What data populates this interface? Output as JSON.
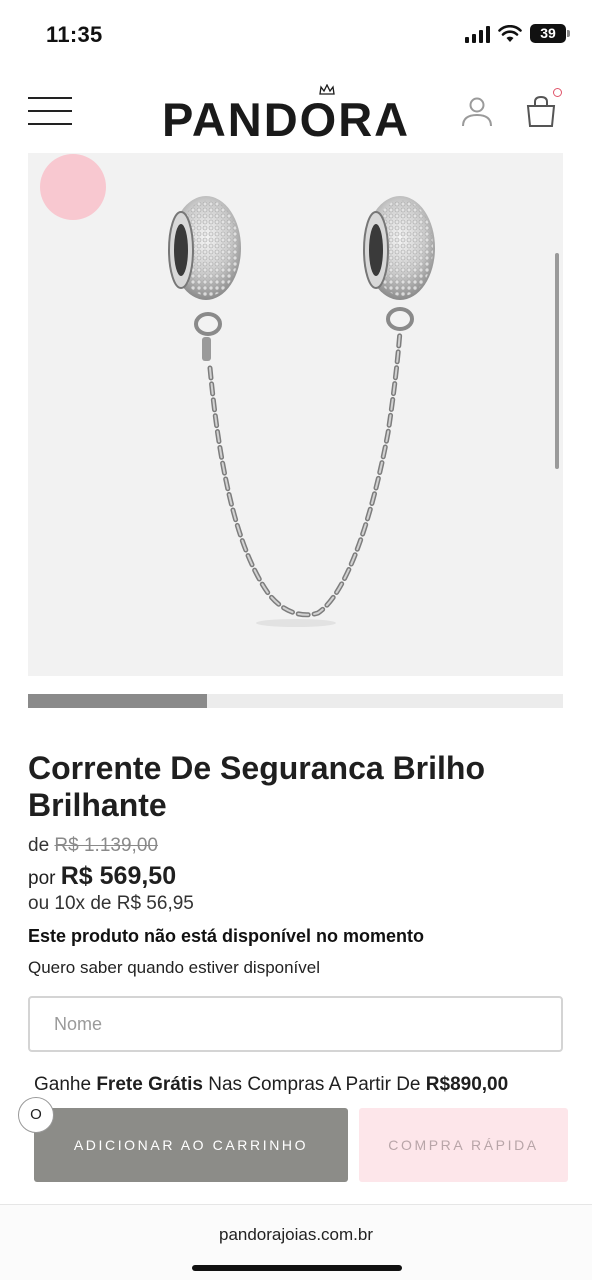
{
  "status_bar": {
    "time": "11:35",
    "battery": "39"
  },
  "header": {
    "logo": "PANDORA"
  },
  "product": {
    "title": "Corrente De Seguranca Brilho Brilhante",
    "old_price_prefix": "de",
    "old_price": "R$ 1.139,00",
    "price_prefix": "por",
    "price": "R$ 569,50",
    "installments": "ou 10x de R$ 56,95",
    "availability": "Este produto não está disponível no momento",
    "notify_text": "Quero saber quando estiver disponível",
    "name_placeholder": "Nome",
    "carousel_progress": 0.335
  },
  "shipping": {
    "prefix": "Ganhe ",
    "bold": "Frete Grátis",
    "middle": " Nas Compras A Partir De ",
    "amount": "R$890,00"
  },
  "actions": {
    "small_circle": "O",
    "add_to_cart": "ADICIONAR AO CARRINHO",
    "quick_buy": "COMPRA RÁPIDA"
  },
  "browser": {
    "url": "pandorajoias.com.br"
  },
  "colors": {
    "accent_pink": "#f8c8d0",
    "button_gray": "#8c8c88",
    "quick_bg": "#fde6ea"
  }
}
